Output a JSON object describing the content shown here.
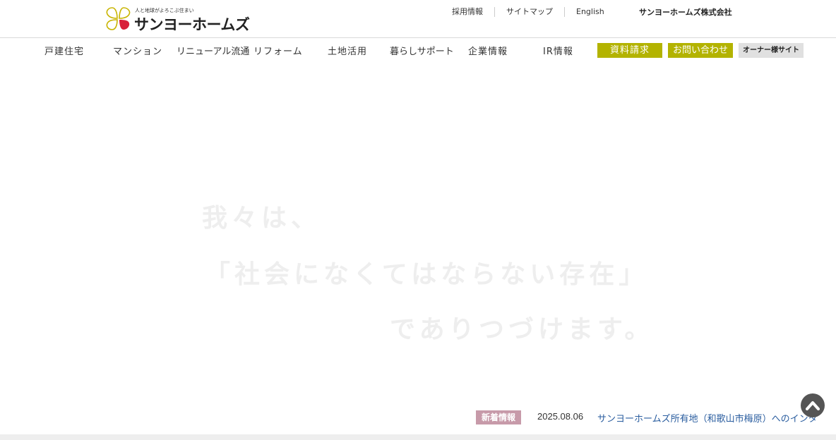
{
  "header": {
    "tagline": "人と地球がよろこぶ住まい",
    "brand": "サンヨーホームズ",
    "utility_links": [
      "採用情報",
      "サイトマップ",
      "English"
    ],
    "company_name": "サンヨーホームズ株式会社"
  },
  "nav": {
    "items": [
      "戸建住宅",
      "マンション",
      "リニューアル流通",
      "リフォーム",
      "土地活用",
      "暮らしサポート",
      "企業情報",
      "IR情報"
    ],
    "request_label": "資料請求",
    "contact_label": "お問い合わせ",
    "owner_label": "オーナー様サイト"
  },
  "hero": {
    "line1": "我々は、",
    "line2": "「社会になくてはならない存在」",
    "line3": "でありつづけます。"
  },
  "news": {
    "label": "新着情報",
    "date": "2025.08.06",
    "title": "サンヨーホームズ所有地（和歌山市梅原）へのインタ"
  },
  "colors": {
    "accent": "#b3b300",
    "news_label": "#c79aa9",
    "link": "#2a5d9f",
    "logo_red": "#d8203a",
    "logo_yellow": "#c8b400"
  },
  "icons": {
    "logo": "clover-heart-icon",
    "pagetop": "chevron-up-icon"
  }
}
